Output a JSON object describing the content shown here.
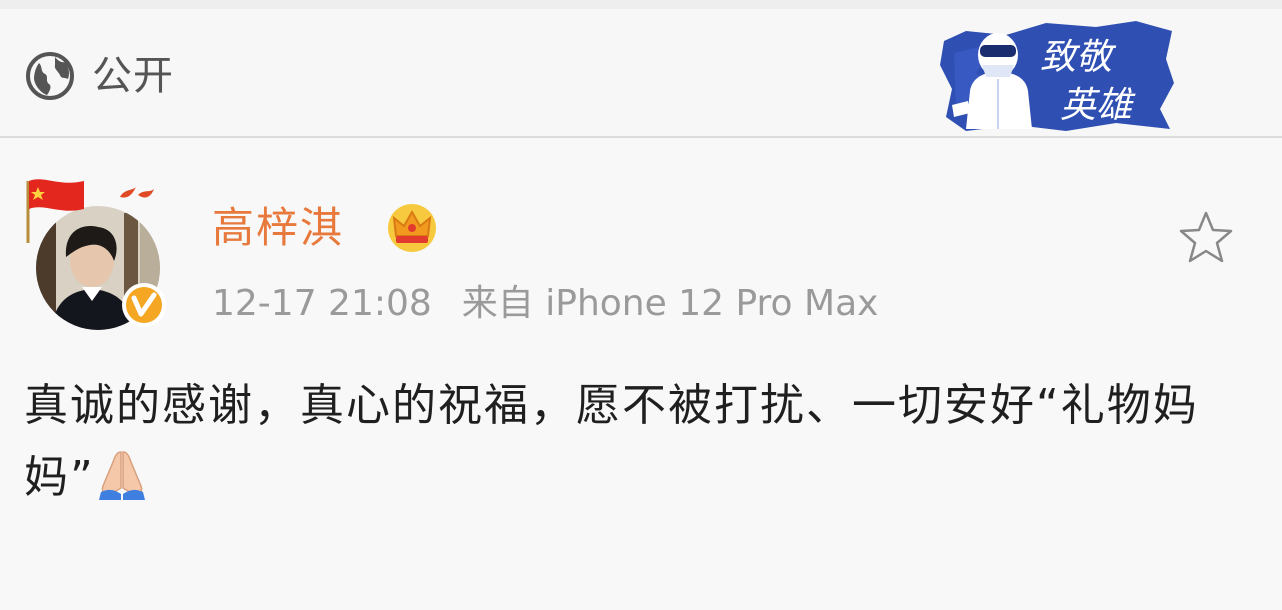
{
  "header": {
    "privacy_icon": "globe-icon",
    "privacy_label": "公开",
    "badge": {
      "icon": "medical-hero-badge-icon",
      "text_line1": "致敬",
      "text_line2": "英雄",
      "color": "#2f4fb3"
    }
  },
  "post": {
    "author": {
      "name": "高梓淇",
      "name_color": "#e8793d",
      "crown_icon": "crown-icon",
      "verified_icon": "verified-v-icon"
    },
    "timestamp": "12-17 21:08",
    "source": "来自 iPhone 12 Pro Max",
    "favorite_icon": "star-outline-icon",
    "content_text": "真诚的感谢，真心的祝福，愿不被打扰、一切安好“礼物妈妈”",
    "content_emoji": "folded-hands-icon"
  }
}
